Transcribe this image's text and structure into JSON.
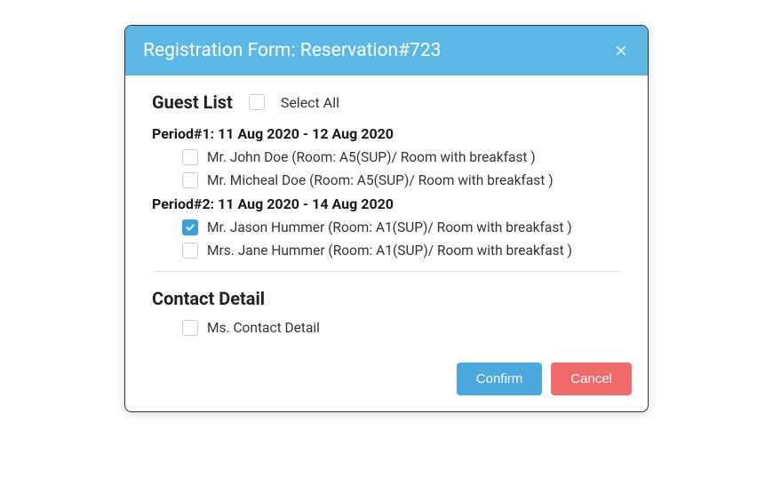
{
  "modal": {
    "title": "Registration Form: Reservation#723",
    "guest_list_heading": "Guest List",
    "select_all_label": "Select All",
    "periods": [
      {
        "title": "Period#1: 11 Aug 2020 - 12 Aug 2020",
        "guests": [
          {
            "label": "Mr. John Doe (Room: A5(SUP)/ Room with breakfast )",
            "checked": false
          },
          {
            "label": "Mr. Micheal Doe (Room: A5(SUP)/ Room with breakfast )",
            "checked": false
          }
        ]
      },
      {
        "title": "Period#2: 11 Aug 2020 - 14 Aug 2020",
        "guests": [
          {
            "label": "Mr. Jason Hummer (Room: A1(SUP)/ Room with breakfast )",
            "checked": true
          },
          {
            "label": "Mrs. Jane Hummer (Room: A1(SUP)/ Room with breakfast )",
            "checked": false
          }
        ]
      }
    ],
    "contact_detail_heading": "Contact Detail",
    "contact": {
      "label": "Ms. Contact Detail",
      "checked": false
    },
    "buttons": {
      "confirm": "Confirm",
      "cancel": "Cancel"
    }
  },
  "colors": {
    "header_bg": "#5bb8e6",
    "primary": "#4aa8df",
    "danger": "#f16a6a"
  }
}
